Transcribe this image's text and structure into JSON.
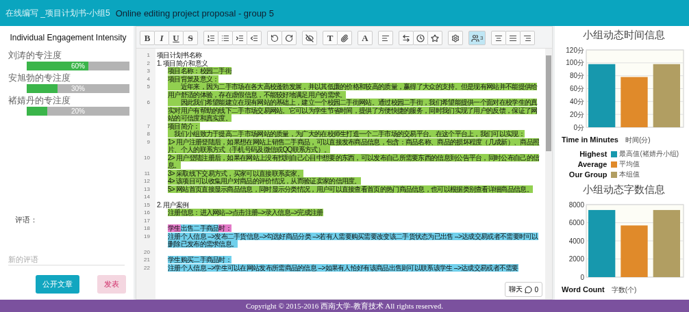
{
  "header": {
    "title": "在线编写 _项目计划书-小组5",
    "subtitle": "Online editing project proposal - group 5"
  },
  "engagement": {
    "title": "Individual Engagement Intensity",
    "members": [
      {
        "name": "刘涛的专注度",
        "level": 0.6,
        "reading": "60%"
      },
      {
        "name": "安旭勃的专注度",
        "level": 0.3,
        "reading": "30%"
      },
      {
        "name": "褚婧丹的专注度",
        "level": 0.2,
        "reading": "20%"
      }
    ]
  },
  "comments": {
    "label": "评语：",
    "placeholder": "新的评语",
    "buttons": [
      {
        "label": "公开文章",
        "kind": "primary"
      },
      {
        "label": "发表",
        "kind": "secondary"
      }
    ]
  },
  "toolbar": {
    "groups": [
      [
        {
          "kind": "letter",
          "label": "B"
        },
        {
          "kind": "letter",
          "label": "I"
        },
        {
          "kind": "letter",
          "label": "U"
        },
        {
          "kind": "letter",
          "label": "S"
        }
      ],
      [
        {
          "kind": "icon"
        },
        {
          "kind": "icon"
        },
        {
          "kind": "icon"
        },
        {
          "kind": "icon"
        }
      ],
      [
        {
          "kind": "icon"
        },
        {
          "kind": "icon"
        }
      ],
      [
        {
          "kind": "icon"
        }
      ],
      [
        {
          "kind": "letter",
          "label": "T"
        },
        {
          "kind": "icon"
        }
      ],
      [
        {
          "kind": "letter",
          "label": "A"
        }
      ],
      [
        {
          "kind": "icon"
        }
      ],
      [
        {
          "kind": "icon"
        },
        {
          "kind": "icon"
        },
        {
          "kind": "icon"
        }
      ],
      [
        {
          "kind": "icon"
        }
      ],
      [
        {
          "kind": "icon",
          "count": "3",
          "selected": true
        }
      ],
      [
        {
          "kind": "icon"
        },
        {
          "kind": "icon"
        },
        {
          "kind": "icon"
        }
      ]
    ]
  },
  "editor": {
    "lines": [
      {
        "number": "1",
        "indented": false,
        "segments": [
          {
            "text": " 项目计划书名称"
          }
        ]
      },
      {
        "number": "2",
        "indented": false,
        "segments": [
          {
            "text": "1. 项目简介和意义"
          }
        ]
      },
      {
        "number": "3",
        "indented": true,
        "segments": [
          {
            "text": "项目名称：校园二手街",
            "color": "#92d050"
          }
        ]
      },
      {
        "number": "4",
        "indented": true,
        "segments": [
          {
            "text": "项目背景及意义：",
            "color": "#92d050"
          }
        ]
      },
      {
        "number": "5",
        "indented": true,
        "segments": [
          {
            "text": "　　近年来，因为二手市场在各大高校蓬勃发展，并以其低廉的价格和较高的质量，赢得了大众的支持。但是现有网站并不能提供给用户舒适的体验，存在虚假信息，不能较好地满足用户的需求。",
            "color": "#92d050"
          }
        ]
      },
      {
        "number": "6",
        "indented": true,
        "segments": [
          {
            "text": "　　因此我们希望能建立在现有网站的基础上，建立一个校园二手街网站。通过校园二手街，我们希望能提供一个面对在校学生的真实对用户有帮助的线下二手市场交易网站。它可以为学生节省时间，提供了方便快捷的服务，同时我们实现了用户的反馈，保证了网站的可信度和真实度。",
            "color": "#92d050"
          }
        ]
      },
      {
        "number": "7",
        "indented": true,
        "segments": [
          {
            "text": "项目简介：",
            "color": "#92d050"
          }
        ]
      },
      {
        "number": "8",
        "indented": true,
        "segments": [
          {
            "text": "　我们小组致力于提高二手市场网站的质量，为广大的在校师生打造一个二手市场的交易平台。在这个平台上，我们可以实现：",
            "color": "#92d050"
          }
        ]
      },
      {
        "number": "9",
        "indented": true,
        "segments": [
          {
            "text": "1> 用户注册登陆后，如果想在网站上销售二手商品，可以直接发布商品信息，包含：商品名称、商品的损坏程度（几成新）、商品照片、个人的联系方式（手机号码及微信或QQ联系方式）。",
            "color": "#92d050"
          }
        ]
      },
      {
        "number": "10",
        "indented": true,
        "segments": [
          {
            "text": "2> 用户登陆注册后，如果在网站上没有找到自己心目中想要的东西，可以发布自己所需要东西的信息到公告平台，同时公布自己的信息。",
            "color": "#92d050"
          }
        ]
      },
      {
        "number": "11",
        "indented": true,
        "segments": [
          {
            "text": "3> 采取线下交易方式，买家可以直接联系卖家。",
            "color": "#92d050"
          }
        ]
      },
      {
        "number": "12",
        "indented": true,
        "segments": [
          {
            "text": "4> 该项目可以收集用户对商品的评价情况，从而验证卖家的信用度。",
            "color": "#92d050"
          }
        ]
      },
      {
        "number": "13",
        "indented": true,
        "segments": [
          {
            "text": "5> 网站首页直接显示商品信息，同时显示分类情况，用户可以直接查看首页的热门商品信息，也可以根据类别查看详细商品信息。",
            "color": "#92d050"
          }
        ]
      },
      {
        "number": "14"
      },
      {
        "number": "15",
        "indented": false,
        "segments": [
          {
            "text": "2. 用户案例"
          }
        ]
      },
      {
        "number": "16",
        "indented": true,
        "segments": [
          {
            "text": "注册信息：进入网站-->点击注册-->录入信息-->完成注册",
            "color": "#92d050"
          }
        ]
      },
      {
        "number": "17"
      },
      {
        "number": "18",
        "indented": true,
        "segments": [
          {
            "text": "学生",
            "color": "#e37ac8"
          },
          {
            "text": "出售二手商品",
            "color": "#70d0ec"
          },
          {
            "text": "时：",
            "color": "#e37ac8"
          }
        ]
      },
      {
        "number": "19",
        "indented": true,
        "segments": [
          {
            "text": "注册个人信息 -->发布二手货信息-->勾选好商品分类 -->若有人需要购买需要改变该二手货状态为已出售 -->达成交易或者不需要时可以删除已发布的需求信息。",
            "color": "#70d0ec"
          }
        ]
      },
      {
        "number": "20"
      },
      {
        "number": "21",
        "indented": true,
        "segments": [
          {
            "text": "学生购买二手商品时：",
            "color": "#70d0ec"
          }
        ]
      },
      {
        "number": "22",
        "indented": true,
        "segments": [
          {
            "text": "注册个人信息 -->学生可以在网站发布所需商品的信息 -->如果有人恰好有该商品出售则可以联系该学生 -->达成交易或者不需要",
            "color": "#70d0ec"
          }
        ]
      }
    ],
    "chat": {
      "label": "聊天",
      "count": "0"
    }
  },
  "charts": [
    {
      "note": "Time in Minutes",
      "legend_notes": [
        "Highest",
        "Average",
        "Our Group"
      ],
      "chart_data": {
        "type": "bar",
        "grid": true,
        "title": "小组动态时间信息",
        "xlabel": "时间(分)",
        "ylim": [
          0,
          120
        ],
        "yticks": [
          {
            "value": 0,
            "label": "0分"
          },
          {
            "value": 20,
            "label": "20分"
          },
          {
            "value": 40,
            "label": "40分"
          },
          {
            "value": 60,
            "label": "60分"
          },
          {
            "value": 80,
            "label": "80分"
          },
          {
            "value": 100,
            "label": "100分"
          },
          {
            "value": 120,
            "label": "120分"
          }
        ],
        "series": [
          {
            "name": "最高值(褚婧丹小组)",
            "color": "#1798ad",
            "values": [
              98
            ]
          },
          {
            "name": "平均值",
            "color": "#e08a2a",
            "values": [
              78
            ]
          },
          {
            "name": "本组值",
            "color": "#b19e62",
            "values": [
              98
            ]
          }
        ]
      }
    },
    {
      "note": "Word Count",
      "chart_data": {
        "type": "bar",
        "grid": true,
        "title": "小组动态字数信息",
        "xlabel": "字数(个)",
        "ylim": [
          0,
          8000
        ],
        "yticks": [
          0,
          2000,
          4000,
          6000,
          8000
        ],
        "series": [
          {
            "color": "#1798ad",
            "values": [
              7400
            ]
          },
          {
            "color": "#e08a2a",
            "values": [
              5700
            ]
          },
          {
            "color": "#b19e62",
            "values": [
              7400
            ]
          }
        ]
      }
    }
  ],
  "footer": {
    "text": "Copyright © 2015-2016 西南大学-教育技术 All rights reserved."
  }
}
